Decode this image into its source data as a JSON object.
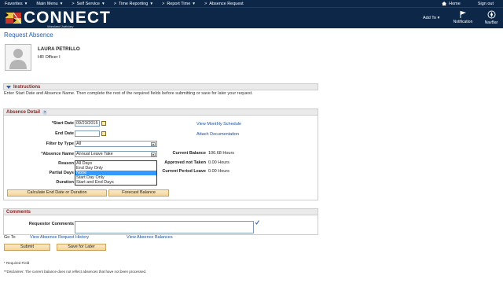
{
  "topnav": {
    "items": [
      "Favorites",
      "Main Menu",
      "Self Service",
      "Time Reporting",
      "Report Time",
      "Absence Request"
    ],
    "home": "Home",
    "signout": "Sign out"
  },
  "header": {
    "logo_text": "CONNECT",
    "logo_sub": "Maryland Judiciary",
    "add_to": "Add To",
    "notification": "Notification",
    "navbar": "NavBar"
  },
  "page": {
    "title": "Request Absence"
  },
  "employee": {
    "name": "LAURA PETRILLO",
    "role": "HR Officer I"
  },
  "instructions": {
    "header": "Instructions",
    "text": "Enter Start Date and Absence Name. Then complete the rest of the required fields before submitting or save for later your request."
  },
  "absence_detail": {
    "header": "Absence Detail",
    "start_date_label": "*Start Date",
    "start_date_value": "09/23/2015",
    "end_date_label": "End Date",
    "end_date_value": "",
    "filter_label": "Filter by Type",
    "filter_value": "All",
    "absence_name_label": "*Absence Name",
    "absence_name_value": "Annual Leave Take",
    "reason_label": "Reason",
    "partial_days_label": "Partial Days",
    "duration_label": "Duration",
    "partial_days_options": [
      "All Days",
      "End Day Only",
      "None",
      "Start Day Only",
      "Start and End Days"
    ],
    "partial_days_selected": "None",
    "view_monthly_schedule": "View Monthly Schedule",
    "attach_documentation": "Attach Documentation",
    "current_balance_label": "Current Balance",
    "current_balance_value": "106.68 Hours",
    "approved_not_taken_label": "Approved not Taken",
    "approved_not_taken_value": "0.00 Hours",
    "current_period_leave_label": "Current Period Leave",
    "current_period_leave_value": "0.00 Hours",
    "calc_button": "Calculate End Date or Duration",
    "forecast_button": "Forecast Balance"
  },
  "comments": {
    "header": "Comments",
    "requestor_label": "Requestor Comments"
  },
  "goto": {
    "label": "Go To",
    "history": "View Absence Request History",
    "balances": "View Absence Balances"
  },
  "actions": {
    "submit": "Submit",
    "save": "Save for Later"
  },
  "footer": {
    "required": "* Required Field",
    "disclaimer": "**Disclaimer: The current balance does not reflect absences that have not been processed."
  }
}
